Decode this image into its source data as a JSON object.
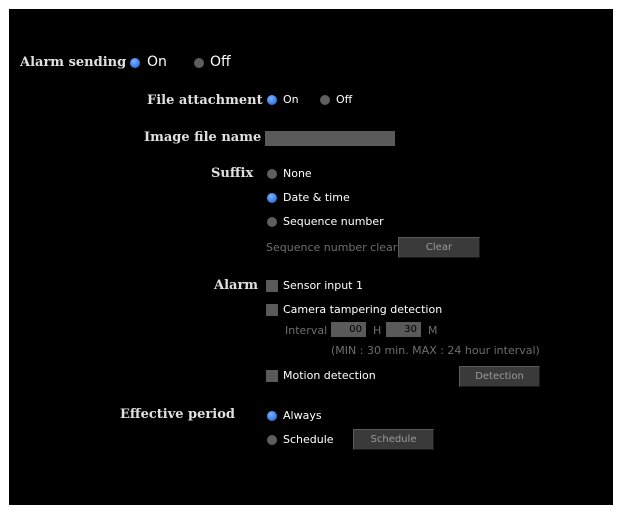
{
  "alarm_sending": {
    "label": "Alarm sending",
    "on_label": "On",
    "off_label": "Off",
    "selected": "On"
  },
  "file_attachment": {
    "label": "File attachment",
    "on_label": "On",
    "off_label": "Off",
    "selected": "On"
  },
  "image_file_name": {
    "label": "Image file name",
    "value": ""
  },
  "suffix": {
    "label": "Suffix",
    "options": [
      "None",
      "Date & time",
      "Sequence number"
    ],
    "selected": "Date & time",
    "sequence_clear_label": "Sequence number clear",
    "clear_button": "Clear"
  },
  "alarm": {
    "label": "Alarm",
    "sensor_input": "Sensor input 1",
    "camera_tampering": "Camera tampering detection",
    "interval_label": "Interval",
    "hours_value": "00",
    "hours_unit": "H",
    "minutes_value": "30",
    "minutes_unit": "M",
    "range_note": "(MIN : 30 min. MAX : 24 hour interval)",
    "motion_detection": "Motion detection",
    "detection_button": "Detection"
  },
  "effective_period": {
    "label": "Effective period",
    "always_label": "Always",
    "schedule_label": "Schedule",
    "schedule_button": "Schedule",
    "selected": "Always"
  },
  "colors": {
    "background": "#000000",
    "radio_selected": "#3a7ff0",
    "control_gray": "#5a5a5a"
  }
}
